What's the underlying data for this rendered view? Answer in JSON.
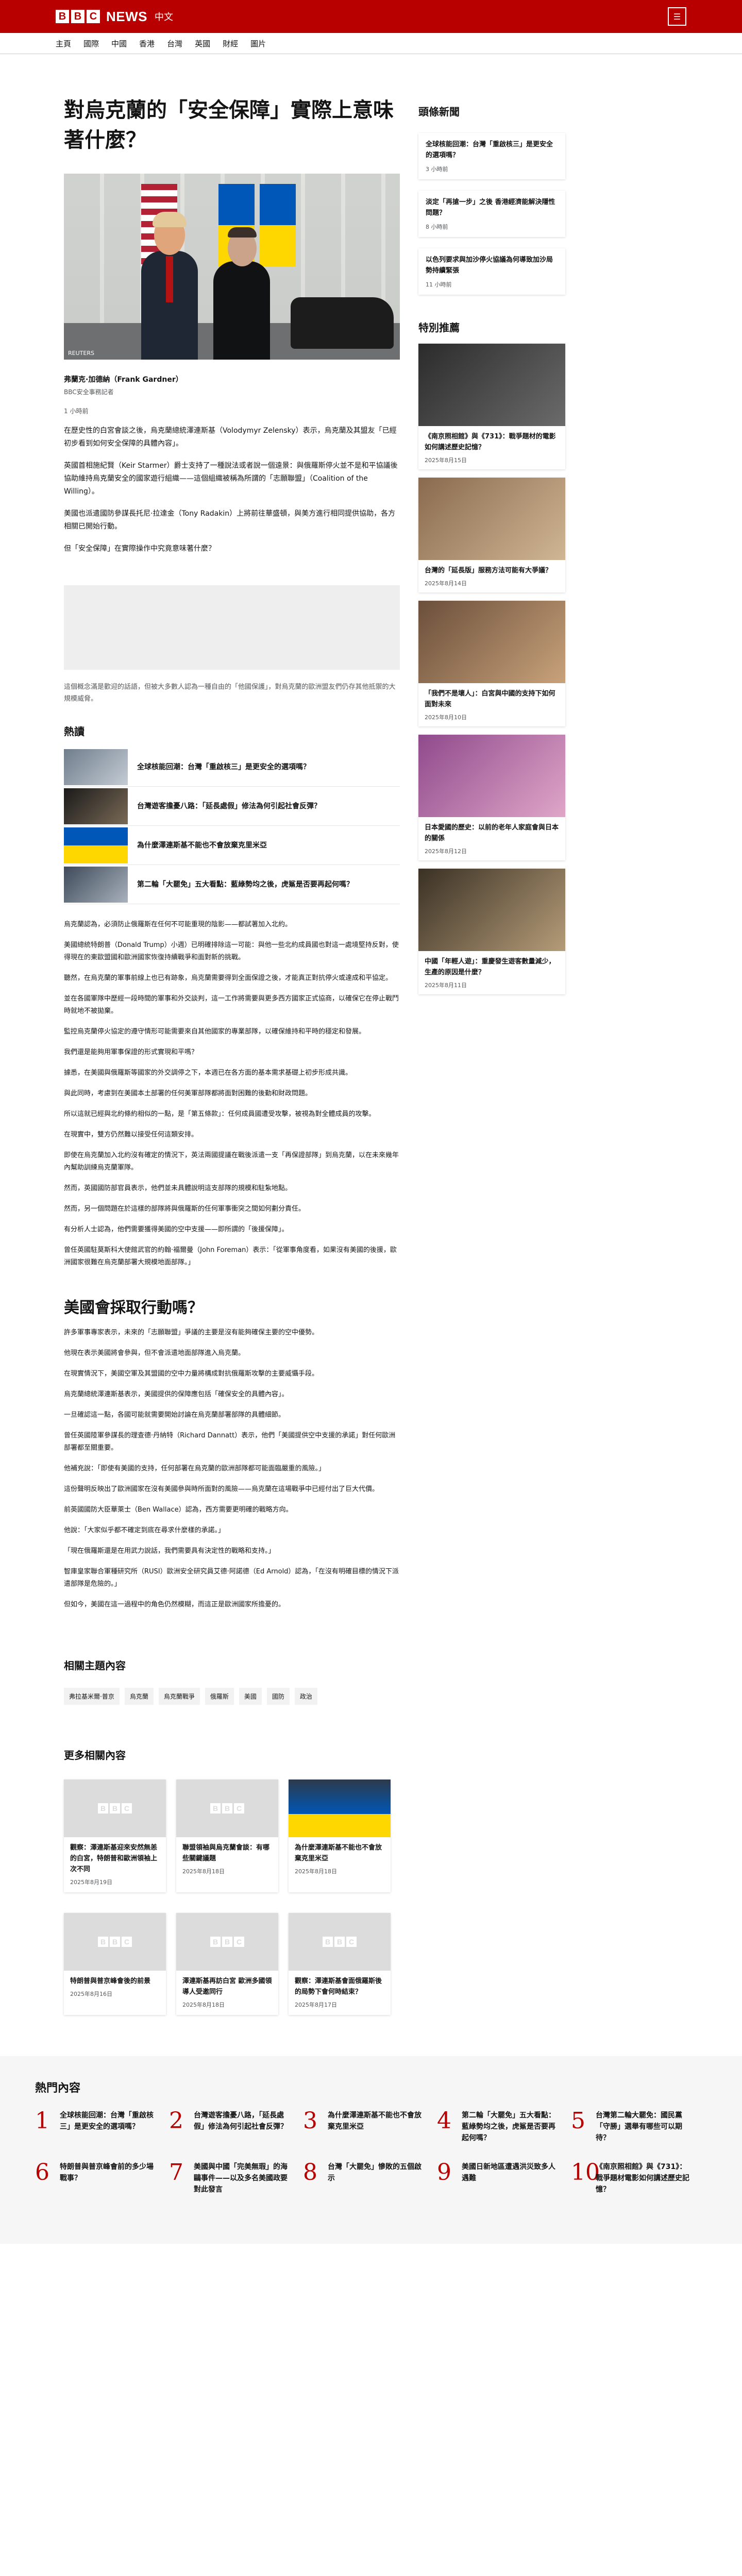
{
  "header": {
    "logo_letters": [
      "B",
      "B",
      "C"
    ],
    "news": "NEWS",
    "lang": "中文",
    "menu_icon": "menu-icon"
  },
  "nav": [
    "主頁",
    "國際",
    "中國",
    "香港",
    "台灣",
    "英國",
    "財經",
    "圖片"
  ],
  "article": {
    "title": "對烏克蘭的「安全保障」實際上意味著什麼？",
    "image_credit": "REUTERS",
    "author": "弗蘭克·加德納（Frank Gardner）",
    "role": "BBC安全事務記者",
    "read_time": "1 小時前",
    "p1": "在歷史性的白宮會談之後，烏克蘭總統澤連斯基（Volodymyr Zelensky）表示，烏克蘭及其盟友「已經初步看到如何安全保障的具體內容」。",
    "p2": "英國首相施紀賢（Keir Starmer）爵士支持了一種說法或者說一個遠景：與俄羅斯停火並不是和平協議後協助維持烏克蘭安全的國家遊行組織——這個組織被稱為所謂的「志願聯盟」（Coalition of the Willing）。",
    "p3": "美國也派遣國防參謀長托尼·拉達金（Tony Radakin）上將前往華盛頓，與美方進行相同提供協助，各方相關已開始行動。",
    "p4": "但「安全保障」在實際操作中究竟意味著什麼？",
    "caption": "這個概念滿是歡迎的話語，但被大多數人認為一種自由的「他國保護」，對烏克蘭的歐洲盟友們仍存其他抵禦的大規模威脅。",
    "hot_title": "熱讀",
    "hot": [
      "全球核能回潮：台灣「重啟核三」是更安全的選項嗎？",
      "台灣遊客擔憂八路：「延長處假」修法為何引起社會反彈？",
      "為什麼澤連斯基不能也不會放棄克里米亞",
      "第二輪「大罷免」五大看點：藍綠勢均之後，虎鯊是否要再起何嗎？"
    ],
    "body": [
      "烏克蘭認為，必須防止俄羅斯在任何不可能重現的陰影——都試著加入北約。",
      "美國總統特朗普（Donald Trump）小週）已明確排除這一可能：與他一些北約成員國也對這一處境堅持反對，使得現在的東歐盟國和歐洲國家恢復持續戰爭和面對新的挑戰。",
      "聽然，在烏克蘭的軍事前線上也已有跡象，烏克蘭需要得到全面保證之後，才能真正對抗停火或達成和平協定。",
      "並在各國軍隊中歷經一段時間的軍事和外交談判，這一工作將需要與更多西方國家正式協商，以確保它在停止戰鬥時就地不被拋棄。",
      "監控烏克蘭停火協定的遵守情形可能需要來自其他國家的專業部隊，以確保維持和平時的穩定和發展。",
      "我們還是能夠用軍事保證的形式實現和平嗎？",
      "據悉，在美國與俄羅斯等國家的外交調停之下，本週已在各方面的基本需求基礎上初步形成共識。",
      "與此同時，考慮到在美國本土部署的任何美軍部隊都將面對困難的後勤和財政問題。",
      "所以這就已經與北約條約相似的一點，是「第五條款」：任何成員國遭受攻擊，被視為對全體成員的攻擊。",
      "在現實中，雙方仍然難以接受任何這類安排。",
      "即使在烏克蘭加入北約沒有確定的情況下，英法兩國提議在戰後派遣一支「再保證部隊」到烏克蘭，以在未來幾年內幫助訓練烏克蘭軍隊。",
      "然而，英國國防部官員表示，他們並未具體說明這支部隊的規模和駐紮地點。",
      "然而，另一個問題在於這樣的部隊將與俄羅斯的任何軍事衝突之間如何劃分責任。",
      "有分析人士認為，他們需要獲得美國的空中支援——即所謂的「後援保障」。",
      "曾任英國駐莫斯科大使館武官的約翰·福爾曼（John Foreman）表示：「從軍事角度看，如果沒有美國的後援，歐洲國家很難在烏克蘭部署大規模地面部隊。」"
    ],
    "sub_title": "美國會採取行動嗎？",
    "body2": [
      "許多軍事專家表示，未來的「志願聯盟」爭議的主要是沒有能夠確保主要的空中優勢。",
      "他現在表示美國將會參與，但不會派遣地面部隊進入烏克蘭。",
      "在現實情況下，美國空軍及其盟國的空中力量將構成對抗俄羅斯攻擊的主要威懾手段。",
      "烏克蘭總統澤連斯基表示，美國提供的保障應包括「確保安全的具體內容」。",
      "一旦確認這一點，各國可能就需要開始討論在烏克蘭部署部隊的具體細節。",
      "曾任英國陸軍參謀長的理查德·丹納特（Richard Dannatt）表示，他們「美國提供空中支援的承諾」對任何歐洲部署都至關重要。",
      "他補充說：「即使有美國的支持，任何部署在烏克蘭的歐洲部隊都可能面臨嚴重的風險。」",
      "這份聲明反映出了歐洲國家在沒有美國參與時所面對的風險——烏克蘭在這場戰爭中已經付出了巨大代價。",
      "前英國國防大臣華萊士（Ben Wallace）認為，西方需要更明確的戰略方向。",
      "他說：「大家似乎都不確定到底在尋求什麼樣的承諾。」",
      "「現在俄羅斯還是在用武力說話，我們需要具有決定性的戰略和支持。」",
      "智庫皇家聯合軍種研究所（RUSI）歐洲安全研究員艾德·阿諾德（Ed Arnold）認為，「在沒有明確目標的情況下派遣部隊是危險的。」",
      "但如今，美國在這一過程中的角色仍然模糊，而這正是歐洲國家所擔憂的。"
    ],
    "topics_title": "相關主題內容",
    "topics": [
      "弗拉基米爾·普京",
      "烏克蘭",
      "烏克蘭戰爭",
      "俄羅斯",
      "美國",
      "國防",
      "政治"
    ],
    "more_title": "更多相關內容",
    "more": [
      {
        "title": "觀察：澤連斯基迎來安然無恙的白宮，特朗普和歐洲領袖上次不同",
        "date": "2025年8月19日"
      },
      {
        "title": "聯盟領袖與烏克蘭會談：有哪些關鍵議題",
        "date": "2025年8月18日"
      },
      {
        "title": "為什麼澤連斯基不能也不會放棄克里米亞",
        "date": "2025年8月18日"
      },
      {
        "title": "特朗普與普京峰會後的前景",
        "date": "2025年8月16日"
      },
      {
        "title": "澤連斯基再訪白宮 歐洲多國領導人受邀同行",
        "date": "2025年8月18日"
      },
      {
        "title": "觀察：澤連斯基會面俄羅斯後的局勢下會何時結束？",
        "date": "2025年8月17日"
      }
    ]
  },
  "sidebar": {
    "title": "頭條新聞",
    "cards": [
      {
        "title": "全球核能回潮：台灣「重啟核三」是更安全的選項嗎？",
        "time": "3 小時前"
      },
      {
        "title": "淡定「再搶一步」之後 香港經濟能解決隱性問題？",
        "time": "8 小時前"
      },
      {
        "title": "以色列要求與加沙停火協議為何導致加沙局勢持續緊張",
        "time": "11 小時前"
      }
    ],
    "featured_title": "特別推薦",
    "featured": [
      {
        "title": "《南京照相館》與《731》：戰爭題材的電影如何講述歷史記憶？",
        "date": "2025年8月15日"
      },
      {
        "title": "台灣的「延長版」服務方法可能有大爭議？",
        "date": "2025年8月14日"
      },
      {
        "title": "「我們不是壞人」：白宮與中國的支持下如何面對未來",
        "date": "2025年8月10日"
      },
      {
        "title": "日本愛國的歷史：以前的老年人家庭會與日本的關係",
        "date": "2025年8月12日"
      },
      {
        "title": "中國「年輕人遊」：重慶發生遊客數量減少，生產的原因是什麼？",
        "date": "2025年8月11日"
      }
    ]
  },
  "popular": {
    "title": "熱門內容",
    "items": [
      {
        "num": "1",
        "title": "全球核能回潮：台灣「重啟核三」是更安全的選項嗎？"
      },
      {
        "num": "2",
        "title": "台灣遊客擔憂八路，「延長處假」修法為何引起社會反彈？"
      },
      {
        "num": "3",
        "title": "為什麼澤連斯基不能也不會放棄克里米亞"
      },
      {
        "num": "4",
        "title": "第二輪「大罷免」五大看點：藍綠勢均之後，虎鯊是否要再起何嗎？"
      },
      {
        "num": "5",
        "title": "台灣第二輪大罷免：國民黨「守勝」選舉有哪些可以期待？"
      },
      {
        "num": "6",
        "title": "特朗普與普京峰會前的多少場戰事？"
      },
      {
        "num": "7",
        "title": "美國與中國「完美無瑕」的海鷗事件——以及多名美國政要對此發言"
      },
      {
        "num": "8",
        "title": "台灣「大罷免」慘敗的五個啟示"
      },
      {
        "num": "9",
        "title": "美國日新地區遭遇洪災致多人遇難"
      },
      {
        "num": "10",
        "title": "《南京照相館》與《731》：戰爭題材電影如何講述歷史記憶？"
      }
    ]
  },
  "colors": {
    "brand": "#b80000",
    "text": "#141414",
    "muted": "#545658"
  }
}
